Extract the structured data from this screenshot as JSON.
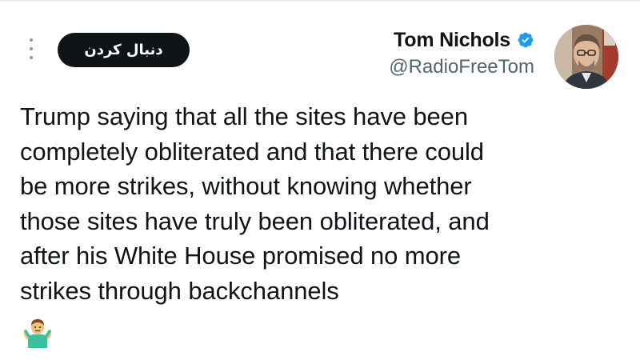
{
  "follow_button": {
    "label": "دنبال کردن"
  },
  "author": {
    "display_name": "Tom Nichols",
    "handle": "@RadioFreeTom",
    "verified": true,
    "verified_color": "#1d9bf0"
  },
  "tweet": {
    "lines": [
      "Trump saying that all the sites have been",
      "completely obliterated and that there could",
      "be more strikes, without knowing whether",
      "those sites have truly been obliterated, and",
      "after his White House promised no more",
      "strikes through backchannels"
    ],
    "emoji": "man-shrugging"
  },
  "icons": {
    "more": "more-vertical-icon",
    "verified": "verified-badge-icon",
    "avatar": "author-avatar"
  },
  "colors": {
    "text": "#0f1419",
    "secondary_text": "#536471",
    "button_bg": "#0f1419",
    "button_text": "#ffffff"
  }
}
